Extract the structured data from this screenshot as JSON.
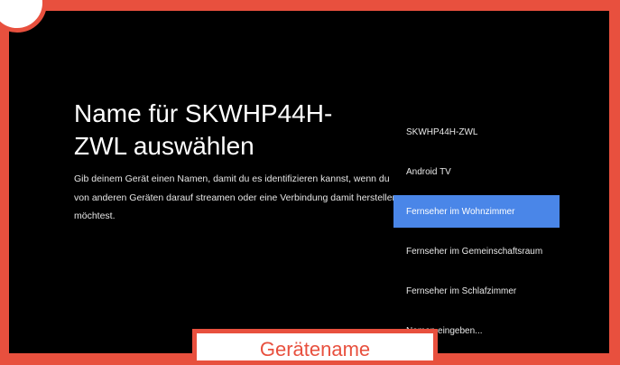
{
  "setup": {
    "title": "Name für SKWHP44H-ZWL auswählen",
    "description": "Gib deinem Gerät einen Namen, damit du es identifizieren kannst, wenn du von anderen Geräten darauf streamen oder eine Verbindung damit herstellen möchtest."
  },
  "options": [
    {
      "label": "SKWHP44H-ZWL"
    },
    {
      "label": "Android TV"
    },
    {
      "label": "Fernseher im Wohnzimmer"
    },
    {
      "label": "Fernseher im Gemeinschaftsraum"
    },
    {
      "label": "Fernseher im Schlafzimmer"
    },
    {
      "label": "Namen eingeben..."
    }
  ],
  "selected_option": "Fernseher im Wohnzimmer",
  "caption": "Gerätename",
  "colors": {
    "accent": "#e8503e",
    "selection": "#4a86e8",
    "background": "#000000"
  }
}
